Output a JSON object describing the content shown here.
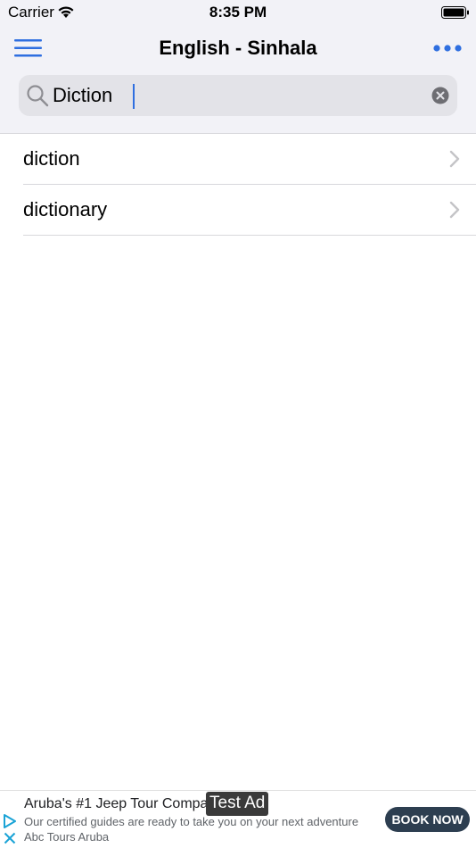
{
  "status_bar": {
    "carrier": "Carrier",
    "time": "8:35 PM"
  },
  "nav": {
    "title": "English - Sinhala",
    "accent_color": "#2f6fe0"
  },
  "search": {
    "value": "Diction",
    "placeholder": ""
  },
  "results": [
    {
      "label": "diction"
    },
    {
      "label": "dictionary"
    }
  ],
  "ad": {
    "title": "Aruba's #1 Jeep Tour Compar",
    "badge": "Test Ad",
    "description": "Our certified guides are ready to take you on your next adventure Abc Tours Aruba",
    "cta": "BOOK NOW",
    "cta_color": "#2d3e50"
  }
}
